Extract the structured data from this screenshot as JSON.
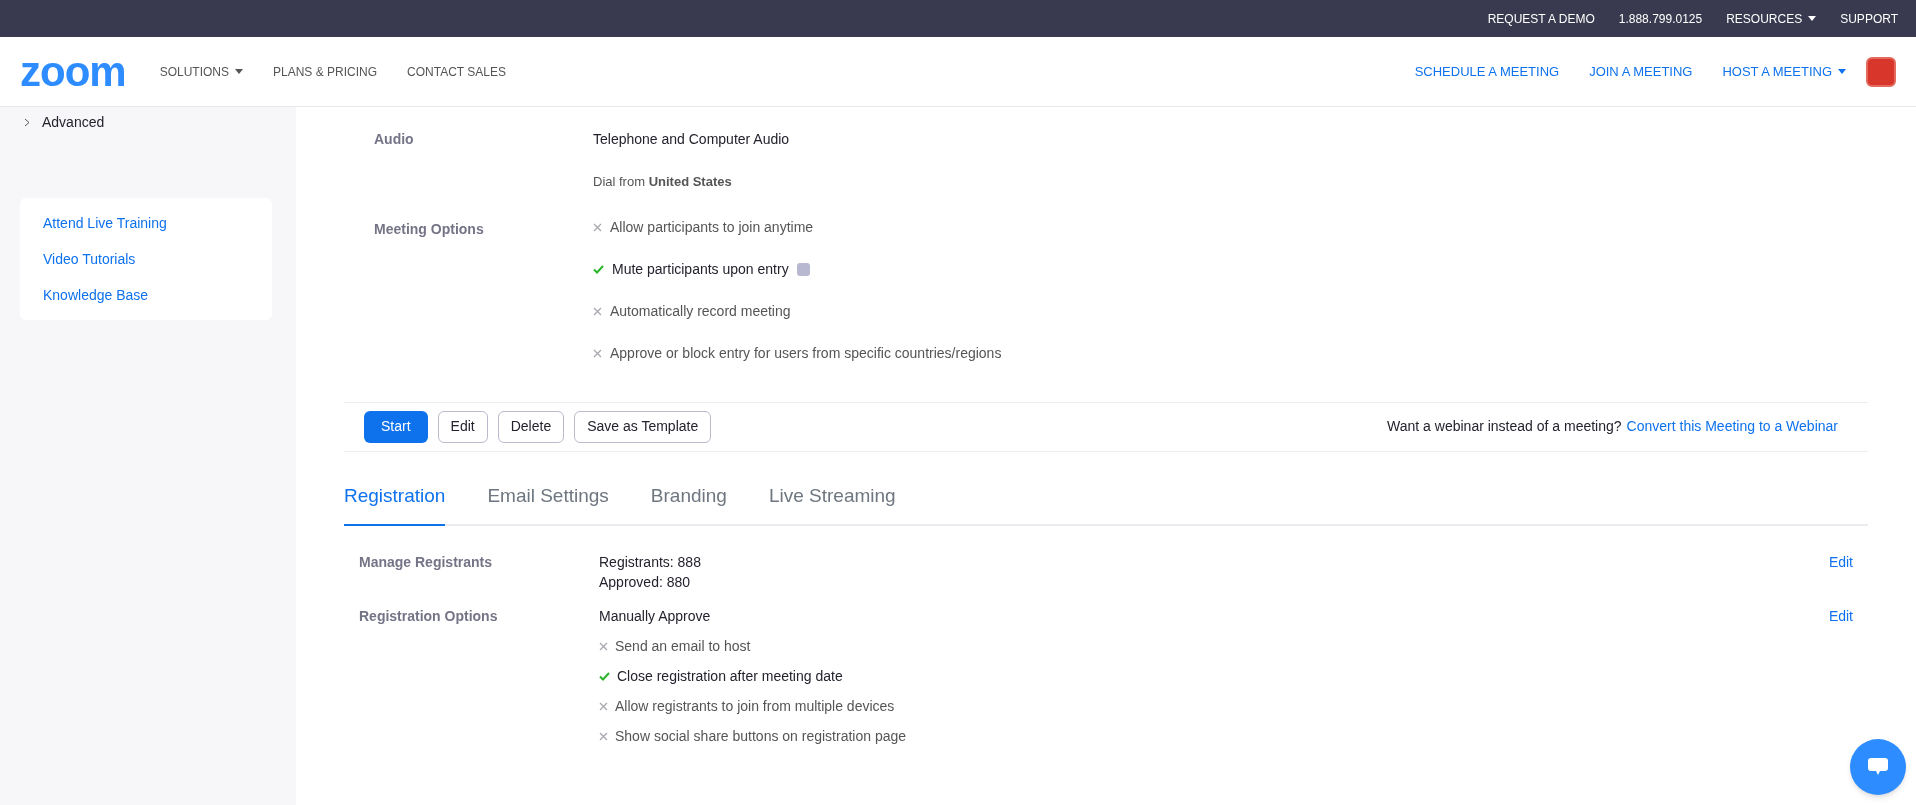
{
  "top_bar": {
    "links": [
      {
        "label": "REQUEST A DEMO",
        "dropdown": false
      },
      {
        "label": "1.888.799.0125",
        "dropdown": false
      },
      {
        "label": "RESOURCES",
        "dropdown": true
      },
      {
        "label": "SUPPORT",
        "dropdown": false
      }
    ]
  },
  "header": {
    "logo": "zoom",
    "nav": [
      {
        "label": "SOLUTIONS",
        "dropdown": true
      },
      {
        "label": "PLANS & PRICING",
        "dropdown": false
      },
      {
        "label": "CONTACT SALES",
        "dropdown": false
      }
    ],
    "actions": [
      {
        "label": "SCHEDULE A MEETING",
        "dropdown": false
      },
      {
        "label": "JOIN A MEETING",
        "dropdown": false
      },
      {
        "label": "HOST A MEETING",
        "dropdown": true
      }
    ]
  },
  "sidebar": {
    "items": [
      {
        "label": "Advanced",
        "expanded": false
      }
    ],
    "help_links": [
      "Attend Live Training",
      "Video Tutorials",
      "Knowledge Base"
    ]
  },
  "meeting": {
    "audio": {
      "label": "Audio",
      "value": "Telephone and Computer Audio",
      "dial_from": "Dial from **United States**"
    },
    "options": {
      "label": "Meeting Options",
      "items": [
        {
          "text": "Allow participants to join anytime",
          "checked": false,
          "badge": false
        },
        {
          "text": "Mute participants upon entry",
          "checked": true,
          "badge": true
        },
        {
          "text": "Automatically record meeting",
          "checked": false,
          "badge": false
        },
        {
          "text": "Approve or block entry for users from specific countries/regions",
          "checked": false,
          "badge": false
        }
      ]
    },
    "buttons": [
      {
        "label": "Start",
        "kind": "primary"
      },
      {
        "label": "Edit",
        "kind": "outline"
      },
      {
        "label": "Delete",
        "kind": "outline"
      },
      {
        "label": "Save as Template",
        "kind": "outline"
      }
    ],
    "webinar_prompt": "Want a webinar instead of a meeting?",
    "webinar_link": "Convert this Meeting to a Webinar"
  },
  "tabs": [
    {
      "label": "Registration",
      "selected": true
    },
    {
      "label": "Email Settings",
      "selected": false
    },
    {
      "label": "Branding",
      "selected": false
    },
    {
      "label": "Live Streaming",
      "selected": false
    }
  ],
  "registration": {
    "manage": {
      "label": "Manage Registrants",
      "lines": [
        "Registrants: 888",
        "Approved: 880"
      ],
      "edit": "Edit"
    },
    "options": {
      "label": "Registration Options",
      "value": "Manually Approve",
      "edit": "Edit",
      "items": [
        {
          "text": "Send an email to host",
          "checked": false
        },
        {
          "text": "Close registration after meeting date",
          "checked": true
        },
        {
          "text": "Allow registrants to join from multiple devices",
          "checked": false
        },
        {
          "text": "Show social share buttons on registration page",
          "checked": false
        }
      ]
    }
  }
}
